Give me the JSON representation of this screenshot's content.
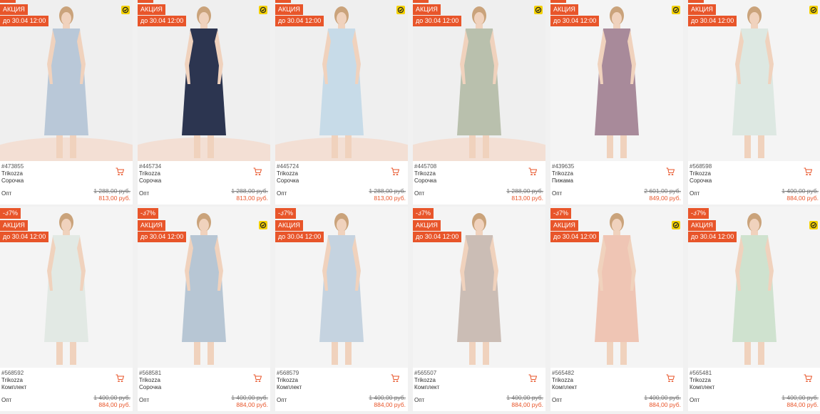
{
  "colors": {
    "accent": "#e8552a",
    "badge": "#e8552a",
    "yellow": "#f4d100"
  },
  "labels": {
    "promo": "АКЦИЯ",
    "opt": "Опт"
  },
  "products": [
    {
      "sku": "#473855",
      "brand": "Trikozza",
      "type": "Сорочка",
      "old_price": "1 288,00 руб.",
      "price": "813,00 руб.",
      "discount": "",
      "promo_until": "до 30.04 12:00",
      "dress_color": "#b9c8d8",
      "bg": "#efefef",
      "floor": "#f3dfd4",
      "has_heart": false
    },
    {
      "sku": "#445734",
      "brand": "Trikozza",
      "type": "Сорочка",
      "old_price": "1 288,00 руб.",
      "price": "813,00 руб.",
      "discount": "",
      "promo_until": "до 30.04 12:00",
      "dress_color": "#2c3550",
      "bg": "#efefef",
      "floor": "#f3dfd4",
      "has_heart": false
    },
    {
      "sku": "#445724",
      "brand": "Trikozza",
      "type": "Сорочка",
      "old_price": "1 288,00 руб.",
      "price": "813,00 руб.",
      "discount": "",
      "promo_until": "до 30.04 12:00",
      "dress_color": "#c7dbe8",
      "bg": "#efefef",
      "floor": "#f3dfd4",
      "has_heart": false
    },
    {
      "sku": "#445708",
      "brand": "Trikozza",
      "type": "Сорочка",
      "old_price": "1 288,00 руб.",
      "price": "813,00 руб.",
      "discount": "",
      "promo_until": "до 30.04 12:00",
      "dress_color": "#b9c0ad",
      "bg": "#efefef",
      "floor": "#f3dfd4",
      "has_heart": false
    },
    {
      "sku": "#439635",
      "brand": "Trikozza",
      "type": "Пижама",
      "old_price": "2 601,00 руб.",
      "price": "849,00 руб.",
      "discount": "",
      "promo_until": "до 30.04 12:00",
      "dress_color": "#a88a9a",
      "bg": "#f4f4f4",
      "floor": "#f4f4f4",
      "has_heart": false
    },
    {
      "sku": "#568598",
      "brand": "Trikozza",
      "type": "Сорочка",
      "old_price": "1 400,00 руб.",
      "price": "884,00 руб.",
      "discount": "",
      "promo_until": "до 30.04 12:00",
      "dress_color": "#dde8e2",
      "bg": "#f4f4f4",
      "floor": "#f4f4f4",
      "has_heart": false
    },
    {
      "sku": "#568592",
      "brand": "Trikozza",
      "type": "Комплект",
      "old_price": "1 400,00 руб.",
      "price": "884,00 руб.",
      "discount": "-37%",
      "promo_until": "до 30.04 12:00",
      "dress_color": "#e2e9e4",
      "bg": "#f4f4f4",
      "floor": "#f4f4f4",
      "has_heart": true
    },
    {
      "sku": "#568581",
      "brand": "Trikozza",
      "type": "Сорочка",
      "old_price": "1 400,00 руб.",
      "price": "884,00 руб.",
      "discount": "-37%",
      "promo_until": "до 30.04 12:00",
      "dress_color": "#b7c6d4",
      "bg": "#f4f4f4",
      "floor": "#f4f4f4",
      "has_heart": true
    },
    {
      "sku": "#568579",
      "brand": "Trikozza",
      "type": "Комплект",
      "old_price": "1 400,00 руб.",
      "price": "884,00 руб.",
      "discount": "-37%",
      "promo_until": "до 30.04 12:00",
      "dress_color": "#c5d3e0",
      "bg": "#f4f4f4",
      "floor": "#f4f4f4",
      "has_heart": true
    },
    {
      "sku": "#565507",
      "brand": "Trikozza",
      "type": "Комплект",
      "old_price": "1 400,00 руб.",
      "price": "884,00 руб.",
      "discount": "-37%",
      "promo_until": "до 30.04 12:00",
      "dress_color": "#cbbdb5",
      "bg": "#f4f4f4",
      "floor": "#f4f4f4",
      "has_heart": true
    },
    {
      "sku": "#565482",
      "brand": "Trikozza",
      "type": "Комплект",
      "old_price": "1 400,00 руб.",
      "price": "884,00 руб.",
      "discount": "-37%",
      "promo_until": "до 30.04 12:00",
      "dress_color": "#efc5b4",
      "bg": "#f4f4f4",
      "floor": "#f4f4f4",
      "has_heart": true
    },
    {
      "sku": "#565481",
      "brand": "Trikozza",
      "type": "Комплект",
      "old_price": "1 400,00 руб.",
      "price": "884,00 руб.",
      "discount": "-37%",
      "promo_until": "до 30.04 12:00",
      "dress_color": "#cfe2cf",
      "bg": "#f4f4f4",
      "floor": "#f4f4f4",
      "has_heart": true
    }
  ]
}
